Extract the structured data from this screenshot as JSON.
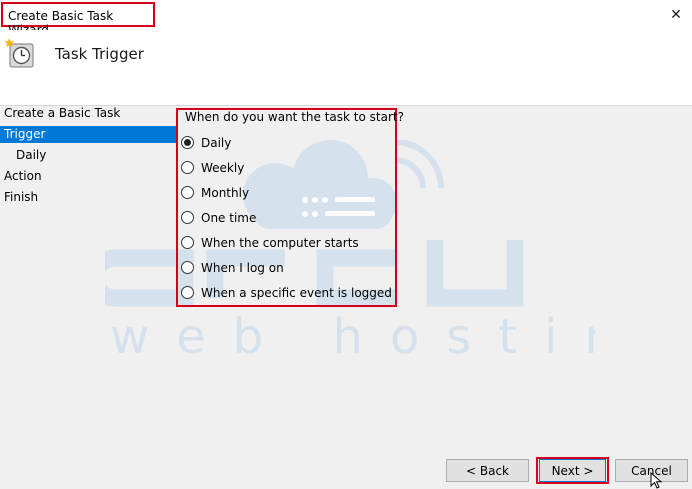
{
  "window": {
    "title": "Create Basic Task Wizard",
    "close_glyph": "✕"
  },
  "header": {
    "title": "Task Trigger",
    "icon": "task-scheduler-clock-icon"
  },
  "nav": {
    "items": [
      {
        "label": "Create a Basic Task",
        "active": false
      },
      {
        "label": "Trigger",
        "active": true
      },
      {
        "label": "Daily",
        "active": false
      },
      {
        "label": "Action",
        "active": false
      },
      {
        "label": "Finish",
        "active": false
      }
    ]
  },
  "trigger": {
    "question": "When do you want the task to start?",
    "options": [
      {
        "label": "Daily",
        "selected": true
      },
      {
        "label": "Weekly",
        "selected": false
      },
      {
        "label": "Monthly",
        "selected": false
      },
      {
        "label": "One time",
        "selected": false
      },
      {
        "label": "When the computer starts",
        "selected": false
      },
      {
        "label": "When I log on",
        "selected": false
      },
      {
        "label": "When a specific event is logged",
        "selected": false
      }
    ]
  },
  "buttons": {
    "back": "< Back",
    "next": "Next >",
    "cancel": "Cancel"
  },
  "watermark": {
    "brand": "arcu",
    "tagline": "web hosting"
  },
  "colors": {
    "highlight": "#d6001c",
    "selection": "#0078d7",
    "watermark": "#c9d8e6"
  }
}
